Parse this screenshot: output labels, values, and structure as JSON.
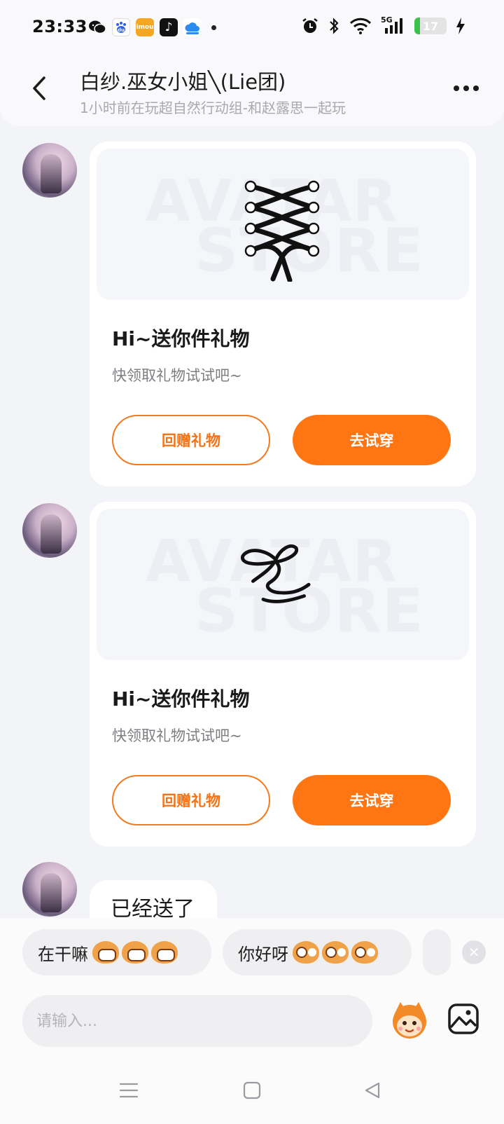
{
  "status_bar": {
    "time": "23:33",
    "apps": [
      {
        "name": "wechat-icon",
        "glyph": "✉",
        "color": "#111111"
      },
      {
        "name": "baidu-icon",
        "glyph": "du",
        "color": "#2f5fe8"
      },
      {
        "name": "imou-icon",
        "glyph": "imou",
        "color": "#f5a623"
      },
      {
        "name": "tiktok-icon",
        "glyph": "♪",
        "color": "#111111"
      },
      {
        "name": "cloud-icon",
        "glyph": "☁",
        "color": "#2a8cf0"
      }
    ],
    "network": "5G",
    "battery": "17",
    "battery_level": 0.17
  },
  "header": {
    "title": "白纱.巫女小姐╲(Lie团)",
    "subtitle": "1小时前在玩超自然行动组-和赵露思一起玩"
  },
  "messages": [
    {
      "type": "gift",
      "title": "Hi~送你件礼物",
      "desc": "快领取礼物试试吧~",
      "watermark_top": "AVATAR",
      "watermark_bottom": "STORE",
      "return_label": "回赠礼物",
      "try_label": "去试穿",
      "item_icon": "corset-lace-icon"
    },
    {
      "type": "gift",
      "title": "Hi~送你件礼物",
      "desc": "快领取礼物试试吧~",
      "watermark_top": "AVATAR",
      "watermark_bottom": "STORE",
      "return_label": "回赠礼物",
      "try_label": "去试穿",
      "item_icon": "ribbon-bow-icon"
    },
    {
      "type": "text",
      "text": "已经送了"
    }
  ],
  "quick_replies": [
    {
      "text": "在干嘛"
    },
    {
      "text": "你好呀"
    }
  ],
  "input": {
    "placeholder": "请输入..."
  },
  "colors": {
    "accent": "#ff7512",
    "page_bg": "#f3f4f7"
  }
}
